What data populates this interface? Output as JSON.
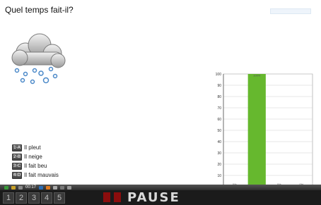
{
  "question": "Quel temps fait-il?",
  "weather_icon": "cloud-snow-icon",
  "answers": [
    {
      "key": "1-A",
      "label": "Il pleut"
    },
    {
      "key": "2-B",
      "label": "Il neige"
    },
    {
      "key": "3-C",
      "label": "Il fait beu"
    },
    {
      "key": "4-D",
      "label": "Il fait mauvais"
    }
  ],
  "taskbar": {
    "readout": "00:17"
  },
  "statusbar": {
    "numbers": [
      "1",
      "2",
      "3",
      "4",
      "5"
    ],
    "pause_label": "PAUSE"
  },
  "colors": {
    "bar": "#66b82e",
    "pause_block": "#8b0d0d"
  },
  "chart_data": {
    "type": "bar",
    "categories": [
      "1-A",
      "2-B",
      "3-C",
      "4-D"
    ],
    "values": [
      0,
      100,
      0,
      0
    ],
    "value_labels": [
      "0%",
      "100%",
      "0%",
      "0%"
    ],
    "ylim": [
      0,
      100
    ],
    "yticks": [
      0,
      10,
      20,
      30,
      40,
      50,
      60,
      70,
      80,
      90,
      100
    ],
    "grid": true
  }
}
